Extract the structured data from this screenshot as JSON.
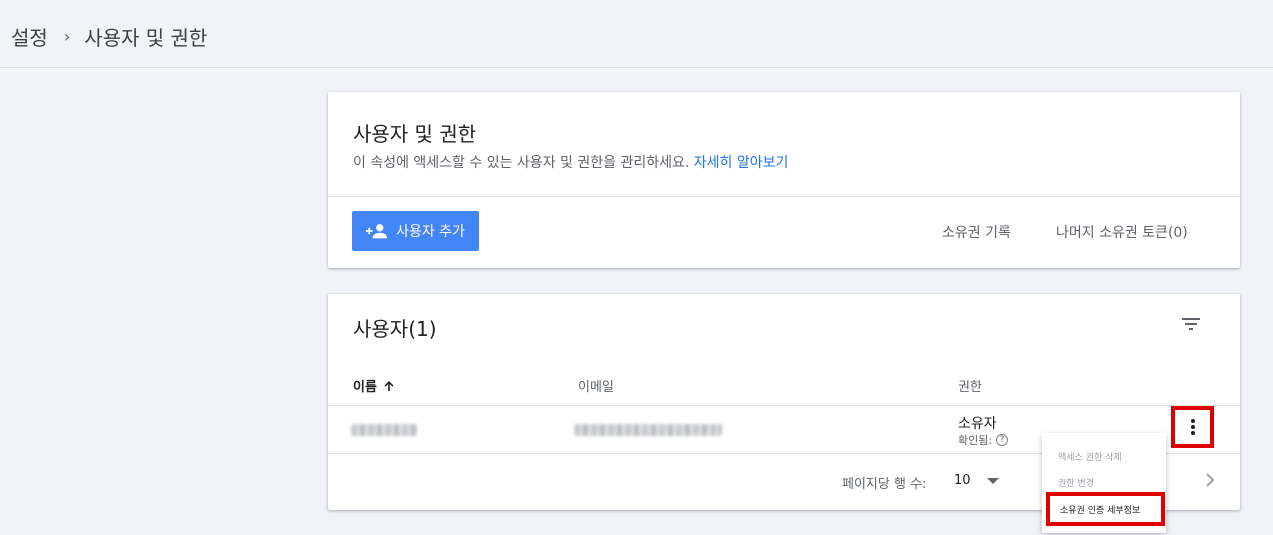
{
  "breadcrumb": {
    "parent": "설정",
    "separator": "›",
    "current": "사용자 및 권한"
  },
  "header_card": {
    "title": "사용자 및 권한",
    "description": "이 속성에 액세스할 수 있는 사용자 및 권한을 관리하세요.",
    "learn_more": "자세히 알아보기",
    "add_user_label": "사용자 추가",
    "ownership_history_label": "소유권 기록",
    "remaining_tokens_label": "나머지 소유권 토큰(0)"
  },
  "users_card": {
    "title": "사용자(1)",
    "columns": {
      "name": "이름",
      "email": "이메일",
      "permission": "권한"
    },
    "rows": [
      {
        "permission": "소유자",
        "verified": "확인됨:",
        "help": "?"
      }
    ],
    "pager": {
      "rows_per_page_label": "페이지당 행 수:",
      "rows_per_page_value": "10"
    }
  },
  "context_menu": {
    "items": [
      "액세스 권한 삭제",
      "권한 변경",
      "소유권 인증 세부정보"
    ]
  },
  "colors": {
    "primary": "#4285f4",
    "link": "#1a73e8",
    "highlight": "#e00000",
    "background": "#f1f3f9"
  },
  "icons": [
    "add-person-icon",
    "filter-icon",
    "sort-up-arrow-icon",
    "help-icon",
    "more-vert-icon",
    "chevron-right-icon",
    "chevron-down-icon"
  ]
}
